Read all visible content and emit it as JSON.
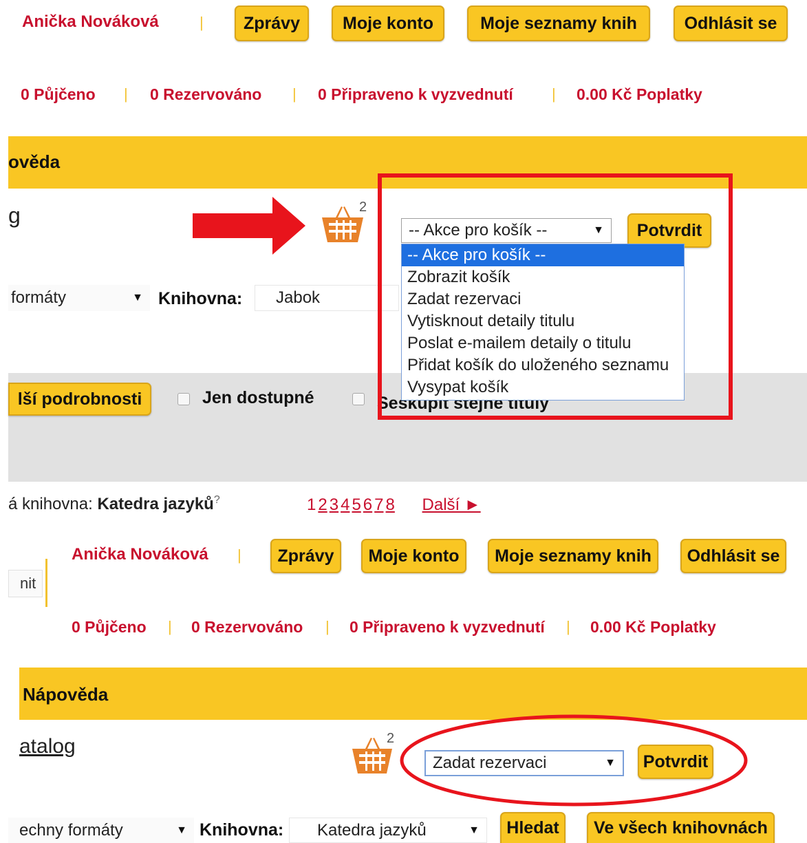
{
  "top": {
    "user_name": "Anička Nováková",
    "buttons": {
      "messages": "Zprávy",
      "account": "Moje konto",
      "lists": "Moje seznamy knih",
      "logout": "Odhlásit se"
    },
    "stats": {
      "borrowed": "0 Půjčeno",
      "reserved": "0 Rezervováno",
      "ready": "0 Připraveno k vyzvednutí",
      "fees": "0.00 Kč Poplatky"
    },
    "band_title": "ověda",
    "catalog_fragment": "g",
    "cart_count": "2",
    "cart_select_value": "-- Akce pro košík --",
    "confirm": "Potvrdit",
    "dropdown_options": [
      "-- Akce pro košík --",
      "Zobrazit košík",
      "Zadat rezervaci",
      "Vytisknout detaily titulu",
      "Poslat e-mailem detaily o titulu",
      "Přidat košík do uloženého seznamu",
      "Vysypat košík"
    ],
    "format_select": "formáty",
    "library_label": "Knihovna:",
    "library_value": "Jabok",
    "more_details": "lší podrobnosti",
    "only_available": "Jen dostupné",
    "group_titles": "Seskupit stejné tituly",
    "current_library_label": "á knihovna:",
    "current_library_value": "Katedra jazyků",
    "help_mark": "?",
    "pages": [
      "1",
      "2",
      "3",
      "4",
      "5",
      "6",
      "7",
      "8"
    ],
    "next": "Další ►"
  },
  "bottom": {
    "user_name": "Anička Nováková",
    "buttons": {
      "messages": "Zprávy",
      "account": "Moje konto",
      "lists": "Moje seznamy knih",
      "logout": "Odhlásit se"
    },
    "left_fragment": "nit",
    "stats": {
      "borrowed": "0 Půjčeno",
      "reserved": "0 Rezervováno",
      "ready": "0 Připraveno k vyzvednutí",
      "fees": "0.00 Kč Poplatky"
    },
    "band_title": "Nápověda",
    "catalog_link": "atalog",
    "cart_count": "2",
    "cart_select_value": "Zadat rezervaci",
    "confirm": "Potvrdit",
    "format_select": "echny formáty",
    "library_label": "Knihovna:",
    "library_value": "Katedra jazyků",
    "search": "Hledat",
    "all_libraries": "Ve všech knihovnách"
  },
  "colors": {
    "accent_yellow": "#f9c623",
    "brand_red": "#c8102e",
    "highlight_red": "#e8141c",
    "selection_blue": "#1e6fe0"
  }
}
